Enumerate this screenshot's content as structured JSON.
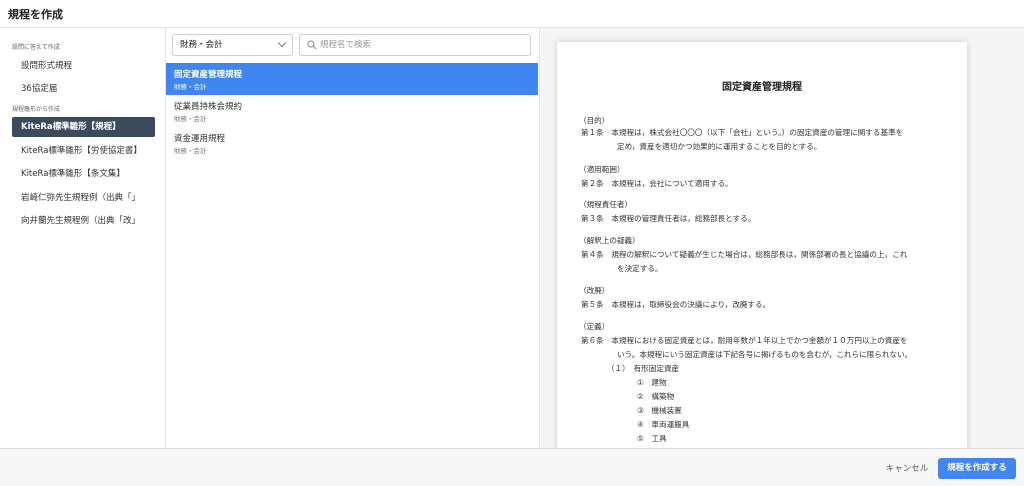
{
  "header": {
    "title": "規程を作成"
  },
  "sidebar": {
    "section1_label": "設問に答えて作成",
    "section1_items": [
      {
        "label": "設問形式規程"
      },
      {
        "label": "36協定届"
      }
    ],
    "section2_label": "規程雛形から作成",
    "section2_items": [
      {
        "label": "KiteRa標準雛形【規程】",
        "active": true
      },
      {
        "label": "KiteRa標準雛形【労使協定書】"
      },
      {
        "label": "KiteRa標準雛形【条文集】"
      },
      {
        "label": "岩崎仁弥先生規程例（出典「」"
      },
      {
        "label": "向井蘭先生規程例（出典「改」"
      }
    ]
  },
  "middle": {
    "category_select": "財務・会計",
    "search_placeholder": "規程名で検索",
    "items": [
      {
        "name": "固定資産管理規程",
        "category": "財務・会計",
        "active": true
      },
      {
        "name": "従業員持株会規約",
        "category": "財務・会計"
      },
      {
        "name": "資金運用規程",
        "category": "財務・会計"
      }
    ]
  },
  "preview": {
    "title": "固定資産管理規程",
    "lines": [
      "（目的）",
      "第１条　本規程は，株式会社〇〇〇（以下「会社」という。）の固定資産の管理に関する基準を",
      "定め，資産を適切かつ効果的に運用することを目的とする。",
      "（適用範囲）",
      "第２条　本規程は，会社について適用する。",
      "（規程責任者）",
      "第３条　本規程の管理責任者は，総務部長とする。",
      "（解釈上の疑義）",
      "第４条　規程の解釈について疑義が生じた場合は，総務部長は，関係部署の長と協議の上，これ",
      "を決定する。",
      "（改廃）",
      "第５条　本規程は，取締役会の決議により，改廃する。",
      "（定義）",
      "第６条　本規程における固定資産とは，耐用年数が１年以上でかつ金額が１０万円以上の資産を",
      "いう。本規程にいう固定資産は下記各号に掲げるものを含むが，これらに限られない。",
      "（１）　有形固定資産",
      "①　建物",
      "②　構築物",
      "③　機械装置",
      "④　車両運搬具",
      "⑤　工具"
    ]
  },
  "footer": {
    "cancel_label": "キャンセル",
    "create_label": "規程を作成する"
  },
  "colors": {
    "accent": "#3f86f2",
    "sidebar_active": "#3c4a5e"
  }
}
